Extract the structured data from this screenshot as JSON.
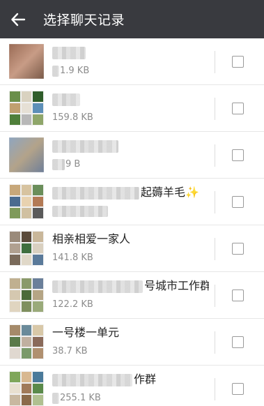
{
  "header": {
    "title": "选择聊天记录",
    "back_icon": "arrow-left-icon"
  },
  "chats": [
    {
      "name_visible": "",
      "name_blurred": true,
      "size": "1.9 KB",
      "size_partial": true,
      "avatar": "single",
      "colors": [
        "#9a6b55",
        "#c89c86",
        "#7a5a48"
      ]
    },
    {
      "name_visible": "",
      "name_blurred": true,
      "size": "159.8 KB",
      "avatar": "grid",
      "colors": [
        "#6a8f4a",
        "#d9d2c0",
        "#2f5d2a",
        "#c0a070",
        "#e6e0d5",
        "#5d8fb8",
        "#4f7f3a",
        "#b8b8b8",
        "#8fa66a"
      ]
    },
    {
      "name_visible": "",
      "name_blurred": true,
      "size": "9 B",
      "size_partial": true,
      "avatar": "single",
      "colors": [
        "#8fa6c0",
        "#b3a38a",
        "#6f7f99"
      ]
    },
    {
      "name_visible": "起薅羊毛✨",
      "name_blurred": true,
      "size": "",
      "avatar": "grid",
      "colors": [
        "#c7a77a",
        "#d7c3a0",
        "#6a8e5a",
        "#4b6b8f",
        "#e8d2b0",
        "#b37a55",
        "#7f9a5a",
        "#d0c0a0",
        "#5a5a5a"
      ]
    },
    {
      "name_visible": "相亲相爱一家人",
      "name_blurred": false,
      "size": "141.8 KB",
      "avatar": "grid",
      "colors": [
        "#9a8a7a",
        "#5a4a3a",
        "#c9b79a",
        "#b0a090",
        "#3f6f3f",
        "#d9d0c0",
        "#7a6a5a",
        "#e0d8c8",
        "#5a7a9a"
      ]
    },
    {
      "name_visible": "号城市工作群",
      "name_blurred": true,
      "size": "122.2 KB",
      "avatar": "grid",
      "colors": [
        "#c0b090",
        "#8a9a6a",
        "#6a7f9a",
        "#d5c8b0",
        "#4a6a3a",
        "#b5a585",
        "#e0d5c0",
        "#7f8f5f",
        "#9aaa7a"
      ]
    },
    {
      "name_visible": "一号楼一单元",
      "name_blurred": false,
      "size": "38.7 KB",
      "avatar": "grid",
      "colors": [
        "#a58a6a",
        "#6a8a9a",
        "#d8c8a8",
        "#5a7a4a",
        "#c0b0a0",
        "#8a6a5a",
        "#e0d8d0",
        "#7a9a6a",
        "#b09070"
      ]
    },
    {
      "name_visible": "作群",
      "name_blurred": true,
      "size": "255.1 KB",
      "size_partial": true,
      "avatar": "grid",
      "colors": [
        "#7fa65a",
        "#d8b890",
        "#4a7a9a",
        "#e8e0d0",
        "#a07a5a",
        "#5a8a4a",
        "#c8b8a0",
        "#8a6a4a",
        "#b0c090"
      ]
    }
  ],
  "icons": {
    "checkbox": "checkbox-empty-icon"
  },
  "colors": {
    "header_bg": "#393a3f",
    "header_text": "#ffffff",
    "name_text": "#222222",
    "size_text": "#8c8c8c"
  }
}
